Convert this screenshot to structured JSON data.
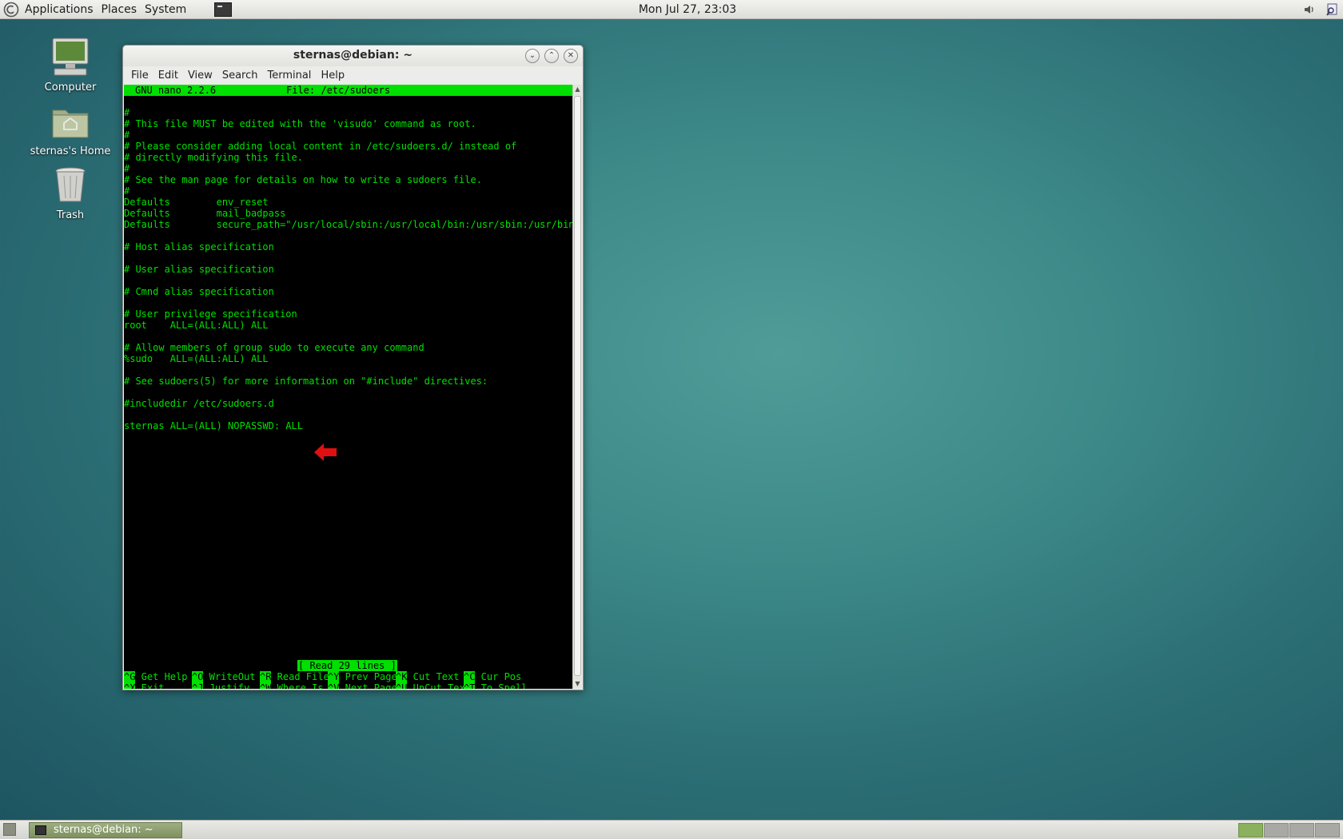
{
  "top_panel": {
    "menus": [
      "Applications",
      "Places",
      "System"
    ],
    "clock": "Mon Jul 27, 23:03"
  },
  "desktop_icons": [
    {
      "label": "Computer",
      "icon": "computer-icon"
    },
    {
      "label": "sternas's Home",
      "icon": "home-folder-icon"
    },
    {
      "label": "Trash",
      "icon": "trash-icon"
    }
  ],
  "window": {
    "title": "sternas@debian: ~",
    "menu": [
      "File",
      "Edit",
      "View",
      "Search",
      "Terminal",
      "Help"
    ]
  },
  "nano": {
    "version": "GNU nano 2.2.6",
    "file": "File: /etc/sudoers",
    "lines": [
      "#",
      "# This file MUST be edited with the 'visudo' command as root.",
      "#",
      "# Please consider adding local content in /etc/sudoers.d/ instead of",
      "# directly modifying this file.",
      "#",
      "# See the man page for details on how to write a sudoers file.",
      "#",
      "Defaults        env_reset",
      "Defaults        mail_badpass",
      "Defaults        secure_path=\"/usr/local/sbin:/usr/local/bin:/usr/sbin:/usr/bin:$",
      "",
      "# Host alias specification",
      "",
      "# User alias specification",
      "",
      "# Cmnd alias specification",
      "",
      "# User privilege specification",
      "root    ALL=(ALL:ALL) ALL",
      "",
      "# Allow members of group sudo to execute any command",
      "%sudo   ALL=(ALL:ALL) ALL",
      "",
      "# See sudoers(5) for more information on \"#include\" directives:",
      "",
      "#includedir /etc/sudoers.d",
      "",
      "sternas ALL=(ALL) NOPASSWD: ALL"
    ],
    "status": "[ Read 29 lines ]",
    "shortcuts": [
      [
        {
          "key": "^G",
          "label": "Get Help"
        },
        {
          "key": "^O",
          "label": "WriteOut"
        },
        {
          "key": "^R",
          "label": "Read File"
        },
        {
          "key": "^Y",
          "label": "Prev Page"
        },
        {
          "key": "^K",
          "label": "Cut Text"
        },
        {
          "key": "^C",
          "label": "Cur Pos"
        }
      ],
      [
        {
          "key": "^X",
          "label": "Exit"
        },
        {
          "key": "^J",
          "label": "Justify"
        },
        {
          "key": "^W",
          "label": "Where Is"
        },
        {
          "key": "^V",
          "label": "Next Page"
        },
        {
          "key": "^U",
          "label": "UnCut Text"
        },
        {
          "key": "^T",
          "label": "To Spell"
        }
      ]
    ]
  },
  "taskbar": {
    "task_label": "sternas@debian: ~",
    "workspaces": 4,
    "active_workspace": 1
  },
  "colors": {
    "terminal_fg": "#00e000",
    "terminal_bg": "#000000",
    "arrow": "#e01010"
  }
}
